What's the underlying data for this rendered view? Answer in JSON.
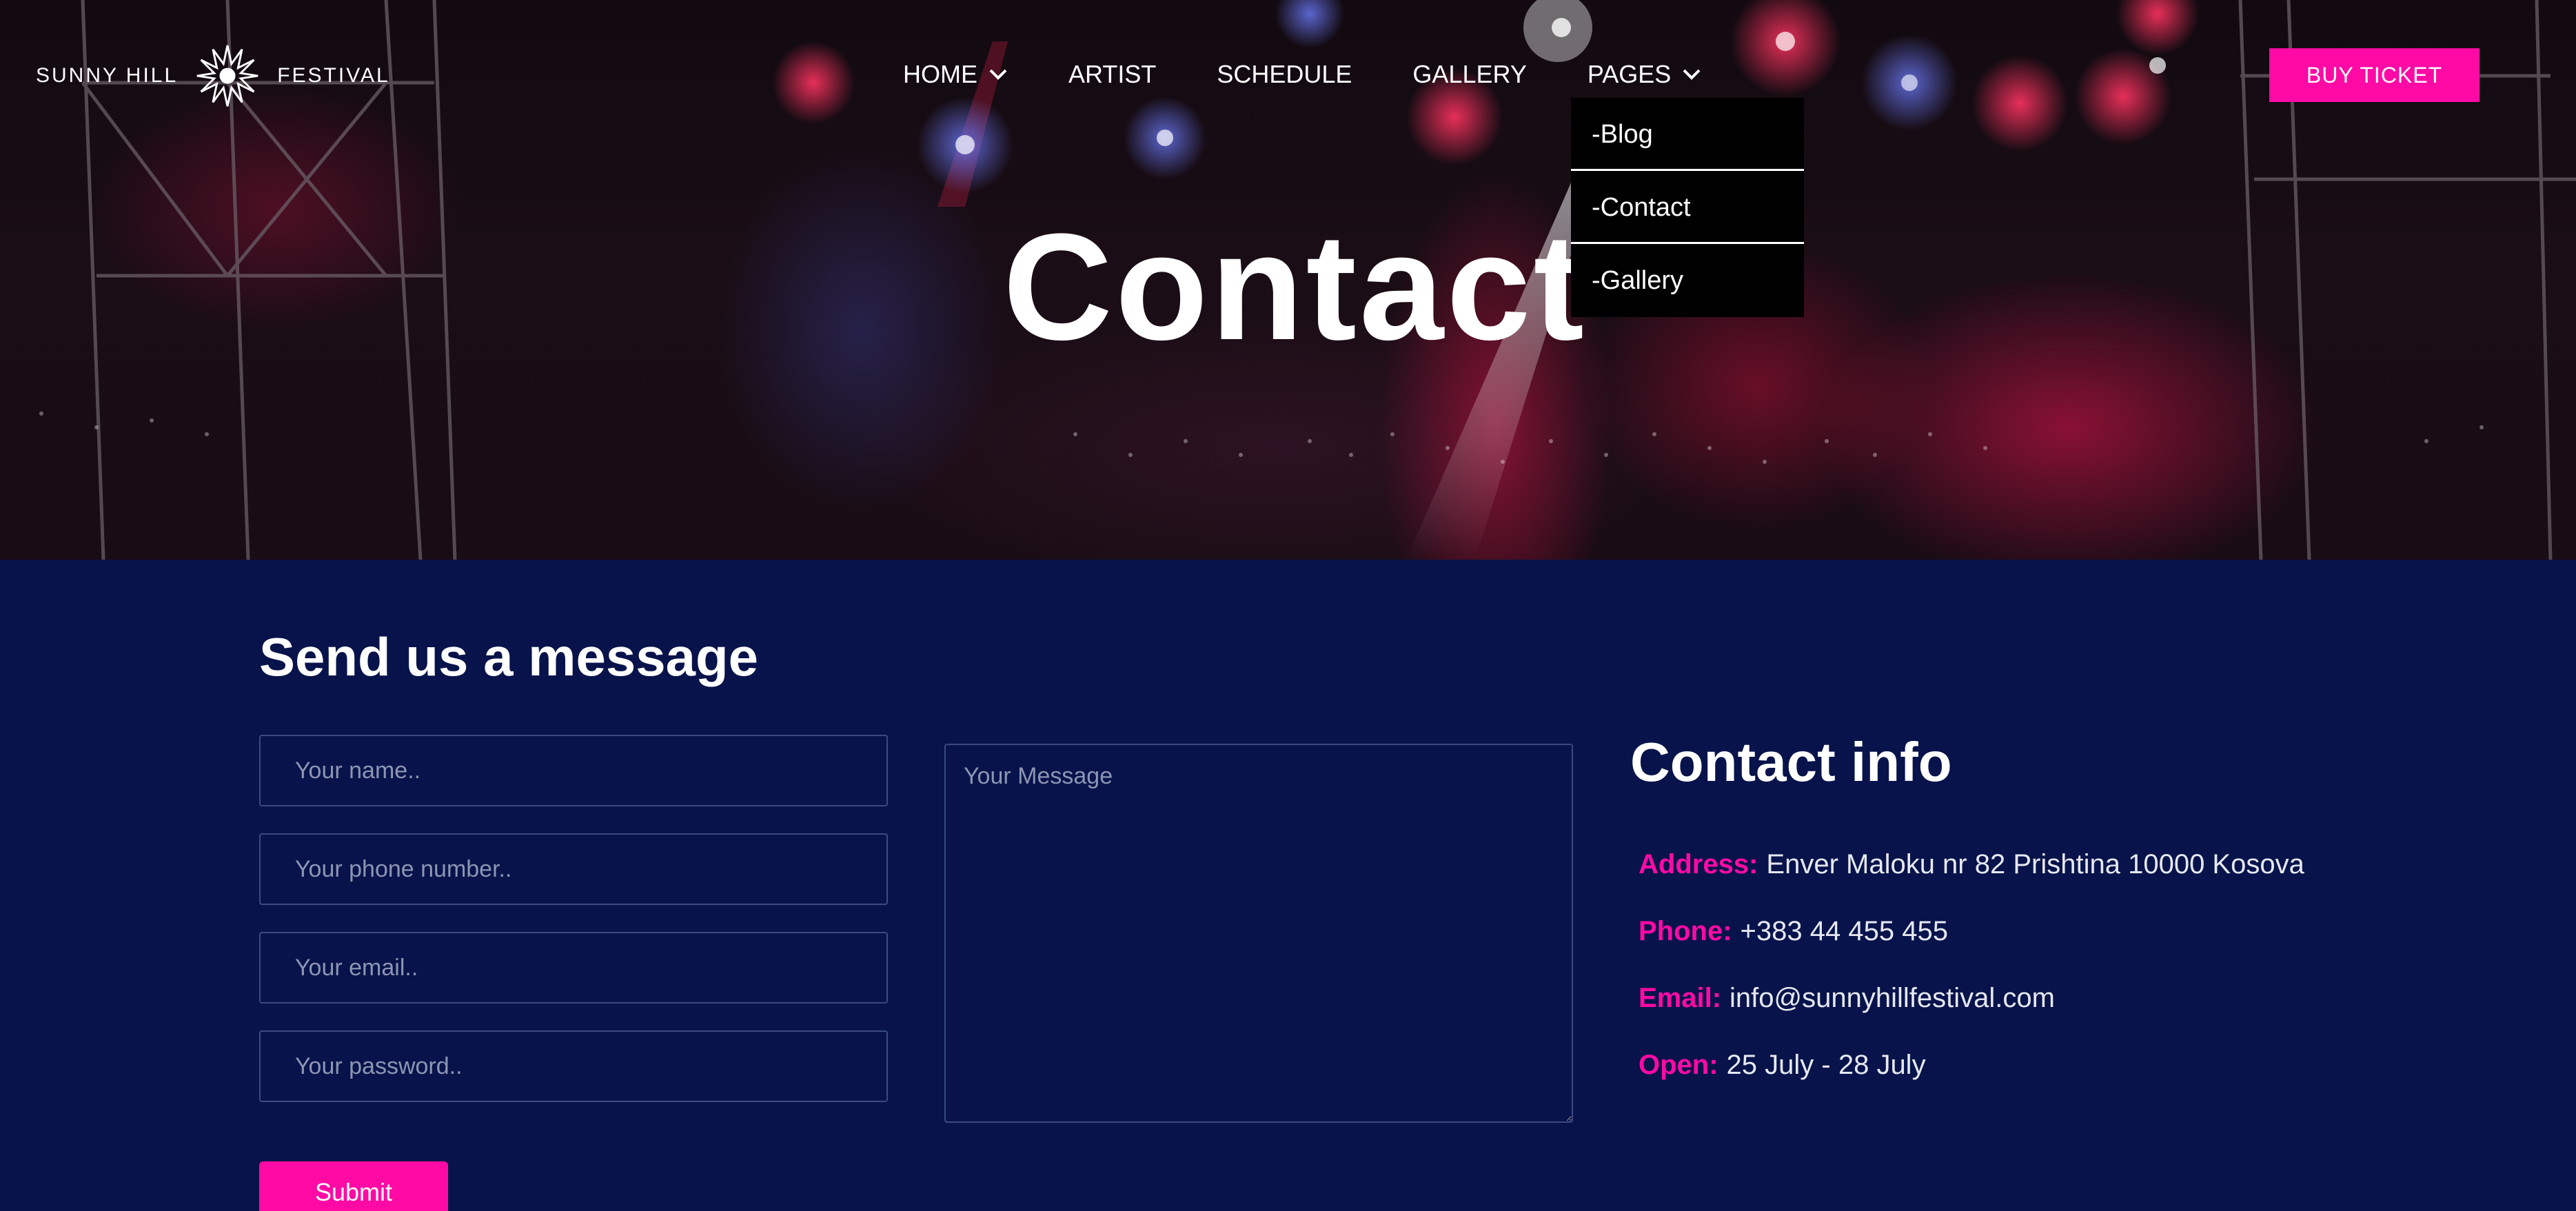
{
  "header": {
    "logo_left": "SUNNY HILL",
    "logo_right": "FESTIVAL",
    "buy_ticket_label": "BUY TICKET"
  },
  "nav": {
    "items": [
      {
        "label": "HOME",
        "has_dropdown": true
      },
      {
        "label": "ARTIST",
        "has_dropdown": false
      },
      {
        "label": "SCHEDULE",
        "has_dropdown": false
      },
      {
        "label": "GALLERY",
        "has_dropdown": false
      },
      {
        "label": "PAGES",
        "has_dropdown": true
      }
    ],
    "pages_dropdown": [
      "-Blog",
      "-Contact",
      "-Gallery"
    ]
  },
  "hero": {
    "title": "Contact"
  },
  "form": {
    "title": "Send us a message",
    "name_placeholder": "Your name..",
    "phone_placeholder": "Your phone number..",
    "email_placeholder": "Your email..",
    "password_placeholder": "Your password..",
    "message_placeholder": "Your Message",
    "submit_label": "Submit"
  },
  "contact_info": {
    "title": "Contact info",
    "rows": [
      {
        "label": "Address:",
        "value": "Enver Maloku nr 82 Prishtina 10000 Kosova"
      },
      {
        "label": "Phone:",
        "value": "+383 44 455 455"
      },
      {
        "label": "Email:",
        "value": "info@sunnyhillfestival.com"
      },
      {
        "label": "Open:",
        "value": "25 July - 28 July"
      }
    ]
  },
  "colors": {
    "accent": "#ff0aa5",
    "background": "#07134a",
    "hero_dark": "#140b12"
  }
}
